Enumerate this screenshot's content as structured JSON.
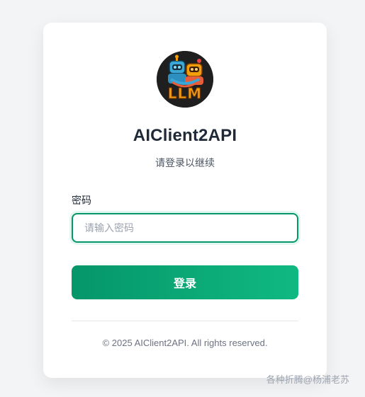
{
  "logo": {
    "text": "LLM",
    "icon": "robot-logo-icon",
    "text_color": "#f59e0b"
  },
  "header": {
    "title": "AIClient2API",
    "subtitle": "请登录以继续"
  },
  "form": {
    "password_label": "密码",
    "password_placeholder": "请输入密码",
    "password_value": "",
    "submit_label": "登录"
  },
  "footer": {
    "copyright": "© 2025 AIClient2API. All rights reserved."
  },
  "watermark": {
    "text": "各种折腾@杨浦老苏"
  },
  "colors": {
    "accent": "#059669",
    "accent_light": "#10b981",
    "background": "#f3f4f6",
    "card": "#ffffff"
  }
}
